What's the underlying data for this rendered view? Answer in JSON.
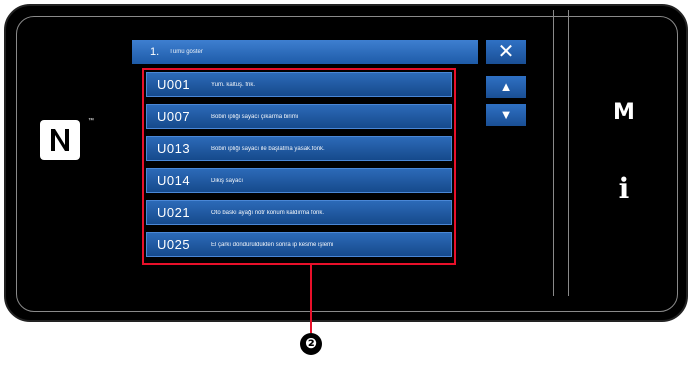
{
  "header": {
    "number": "1.",
    "title": "Tümü göster",
    "close_label": "✕"
  },
  "list": {
    "items": [
      {
        "code": "U001",
        "description": "Yum. kaltuş. fnk."
      },
      {
        "code": "U007",
        "description": "Bobin ipliği sayacı çıkarma birimi"
      },
      {
        "code": "U013",
        "description": "Bobin ipliği sayacı ile başlatma yasak.fonk."
      },
      {
        "code": "U014",
        "description": "Dikiş sayacı"
      },
      {
        "code": "U021",
        "description": "Oto baskı ayağı nötr konum kaldırma fonk."
      },
      {
        "code": "U025",
        "description": "El çarkı döndürüldükten sonra ip kesme işlemi"
      }
    ]
  },
  "scroll": {
    "up_label": "▲",
    "down_label": "▼"
  },
  "side_buttons": {
    "m_label": "M",
    "info_label": "i"
  },
  "nfc": {
    "trademark": "™"
  },
  "callout": {
    "number": "❷"
  },
  "colors": {
    "accent_blue": "#1e5ba8",
    "highlight_red": "#e8102a",
    "device_black": "#000000"
  }
}
